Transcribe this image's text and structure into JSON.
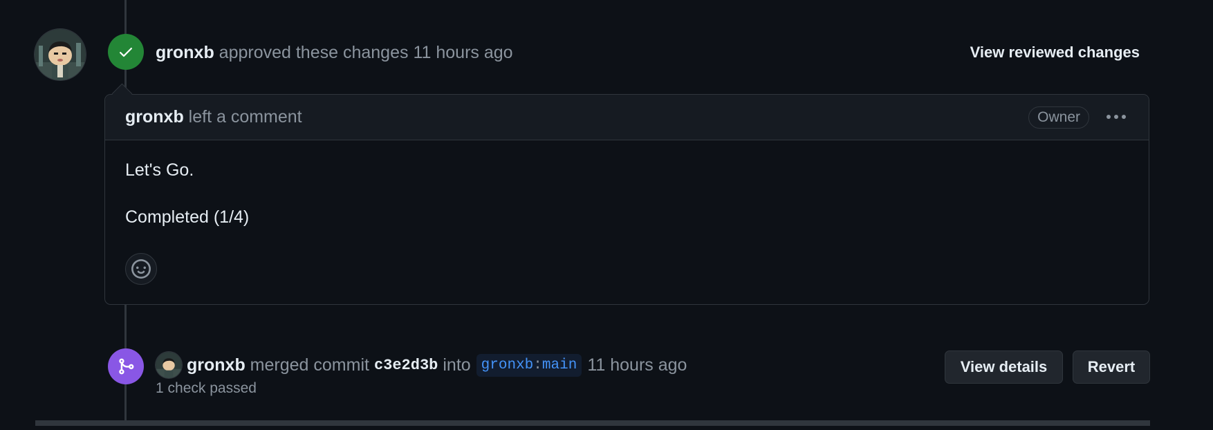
{
  "review": {
    "author": "gronxb",
    "action": "approved these changes",
    "time": "11 hours ago",
    "view_reviewed_label": "View reviewed changes",
    "status_icon": "check-icon",
    "status_color": "#238636"
  },
  "comment": {
    "author": "gronxb",
    "action": "left a comment",
    "role_badge": "Owner",
    "menu_icon": "kebab-horizontal-icon",
    "body_lines": [
      "Let's Go.",
      "Completed (1/4)"
    ],
    "reaction_icon": "smiley-icon"
  },
  "merge": {
    "author": "gronxb",
    "action": "merged commit",
    "commit": "c3e2d3b",
    "into_label": "into",
    "branch_owner": "gronxb",
    "branch_sep": ":",
    "branch_name": "main",
    "time": "11 hours ago",
    "checks": "1 check passed",
    "view_details_label": "View details",
    "revert_label": "Revert",
    "status_icon": "git-merge-icon",
    "status_color": "#8957e5"
  },
  "colors": {
    "background": "#0d1117",
    "border": "#30363d",
    "text_primary": "#e6edf3",
    "text_muted": "#8b949e",
    "link": "#4493f8"
  }
}
